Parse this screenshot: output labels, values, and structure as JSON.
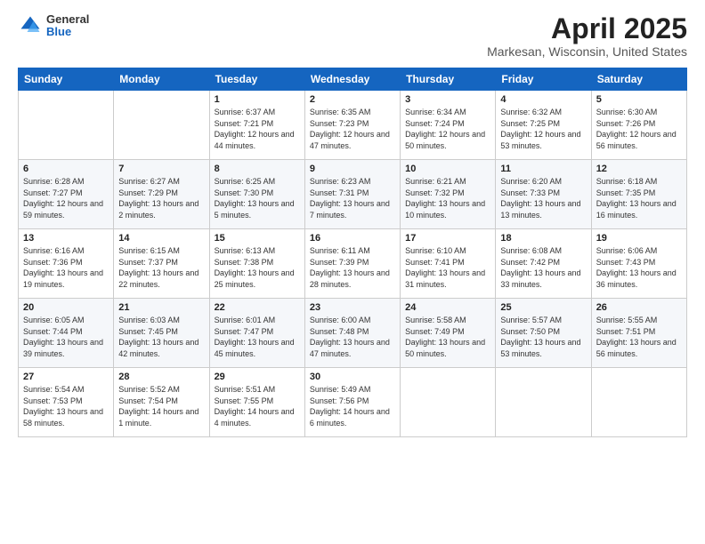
{
  "header": {
    "logo_general": "General",
    "logo_blue": "Blue",
    "month_title": "April 2025",
    "location": "Markesan, Wisconsin, United States"
  },
  "weekdays": [
    "Sunday",
    "Monday",
    "Tuesday",
    "Wednesday",
    "Thursday",
    "Friday",
    "Saturday"
  ],
  "weeks": [
    [
      {
        "day": "",
        "sunrise": "",
        "sunset": "",
        "daylight": ""
      },
      {
        "day": "",
        "sunrise": "",
        "sunset": "",
        "daylight": ""
      },
      {
        "day": "1",
        "sunrise": "Sunrise: 6:37 AM",
        "sunset": "Sunset: 7:21 PM",
        "daylight": "Daylight: 12 hours and 44 minutes."
      },
      {
        "day": "2",
        "sunrise": "Sunrise: 6:35 AM",
        "sunset": "Sunset: 7:23 PM",
        "daylight": "Daylight: 12 hours and 47 minutes."
      },
      {
        "day": "3",
        "sunrise": "Sunrise: 6:34 AM",
        "sunset": "Sunset: 7:24 PM",
        "daylight": "Daylight: 12 hours and 50 minutes."
      },
      {
        "day": "4",
        "sunrise": "Sunrise: 6:32 AM",
        "sunset": "Sunset: 7:25 PM",
        "daylight": "Daylight: 12 hours and 53 minutes."
      },
      {
        "day": "5",
        "sunrise": "Sunrise: 6:30 AM",
        "sunset": "Sunset: 7:26 PM",
        "daylight": "Daylight: 12 hours and 56 minutes."
      }
    ],
    [
      {
        "day": "6",
        "sunrise": "Sunrise: 6:28 AM",
        "sunset": "Sunset: 7:27 PM",
        "daylight": "Daylight: 12 hours and 59 minutes."
      },
      {
        "day": "7",
        "sunrise": "Sunrise: 6:27 AM",
        "sunset": "Sunset: 7:29 PM",
        "daylight": "Daylight: 13 hours and 2 minutes."
      },
      {
        "day": "8",
        "sunrise": "Sunrise: 6:25 AM",
        "sunset": "Sunset: 7:30 PM",
        "daylight": "Daylight: 13 hours and 5 minutes."
      },
      {
        "day": "9",
        "sunrise": "Sunrise: 6:23 AM",
        "sunset": "Sunset: 7:31 PM",
        "daylight": "Daylight: 13 hours and 7 minutes."
      },
      {
        "day": "10",
        "sunrise": "Sunrise: 6:21 AM",
        "sunset": "Sunset: 7:32 PM",
        "daylight": "Daylight: 13 hours and 10 minutes."
      },
      {
        "day": "11",
        "sunrise": "Sunrise: 6:20 AM",
        "sunset": "Sunset: 7:33 PM",
        "daylight": "Daylight: 13 hours and 13 minutes."
      },
      {
        "day": "12",
        "sunrise": "Sunrise: 6:18 AM",
        "sunset": "Sunset: 7:35 PM",
        "daylight": "Daylight: 13 hours and 16 minutes."
      }
    ],
    [
      {
        "day": "13",
        "sunrise": "Sunrise: 6:16 AM",
        "sunset": "Sunset: 7:36 PM",
        "daylight": "Daylight: 13 hours and 19 minutes."
      },
      {
        "day": "14",
        "sunrise": "Sunrise: 6:15 AM",
        "sunset": "Sunset: 7:37 PM",
        "daylight": "Daylight: 13 hours and 22 minutes."
      },
      {
        "day": "15",
        "sunrise": "Sunrise: 6:13 AM",
        "sunset": "Sunset: 7:38 PM",
        "daylight": "Daylight: 13 hours and 25 minutes."
      },
      {
        "day": "16",
        "sunrise": "Sunrise: 6:11 AM",
        "sunset": "Sunset: 7:39 PM",
        "daylight": "Daylight: 13 hours and 28 minutes."
      },
      {
        "day": "17",
        "sunrise": "Sunrise: 6:10 AM",
        "sunset": "Sunset: 7:41 PM",
        "daylight": "Daylight: 13 hours and 31 minutes."
      },
      {
        "day": "18",
        "sunrise": "Sunrise: 6:08 AM",
        "sunset": "Sunset: 7:42 PM",
        "daylight": "Daylight: 13 hours and 33 minutes."
      },
      {
        "day": "19",
        "sunrise": "Sunrise: 6:06 AM",
        "sunset": "Sunset: 7:43 PM",
        "daylight": "Daylight: 13 hours and 36 minutes."
      }
    ],
    [
      {
        "day": "20",
        "sunrise": "Sunrise: 6:05 AM",
        "sunset": "Sunset: 7:44 PM",
        "daylight": "Daylight: 13 hours and 39 minutes."
      },
      {
        "day": "21",
        "sunrise": "Sunrise: 6:03 AM",
        "sunset": "Sunset: 7:45 PM",
        "daylight": "Daylight: 13 hours and 42 minutes."
      },
      {
        "day": "22",
        "sunrise": "Sunrise: 6:01 AM",
        "sunset": "Sunset: 7:47 PM",
        "daylight": "Daylight: 13 hours and 45 minutes."
      },
      {
        "day": "23",
        "sunrise": "Sunrise: 6:00 AM",
        "sunset": "Sunset: 7:48 PM",
        "daylight": "Daylight: 13 hours and 47 minutes."
      },
      {
        "day": "24",
        "sunrise": "Sunrise: 5:58 AM",
        "sunset": "Sunset: 7:49 PM",
        "daylight": "Daylight: 13 hours and 50 minutes."
      },
      {
        "day": "25",
        "sunrise": "Sunrise: 5:57 AM",
        "sunset": "Sunset: 7:50 PM",
        "daylight": "Daylight: 13 hours and 53 minutes."
      },
      {
        "day": "26",
        "sunrise": "Sunrise: 5:55 AM",
        "sunset": "Sunset: 7:51 PM",
        "daylight": "Daylight: 13 hours and 56 minutes."
      }
    ],
    [
      {
        "day": "27",
        "sunrise": "Sunrise: 5:54 AM",
        "sunset": "Sunset: 7:53 PM",
        "daylight": "Daylight: 13 hours and 58 minutes."
      },
      {
        "day": "28",
        "sunrise": "Sunrise: 5:52 AM",
        "sunset": "Sunset: 7:54 PM",
        "daylight": "Daylight: 14 hours and 1 minute."
      },
      {
        "day": "29",
        "sunrise": "Sunrise: 5:51 AM",
        "sunset": "Sunset: 7:55 PM",
        "daylight": "Daylight: 14 hours and 4 minutes."
      },
      {
        "day": "30",
        "sunrise": "Sunrise: 5:49 AM",
        "sunset": "Sunset: 7:56 PM",
        "daylight": "Daylight: 14 hours and 6 minutes."
      },
      {
        "day": "",
        "sunrise": "",
        "sunset": "",
        "daylight": ""
      },
      {
        "day": "",
        "sunrise": "",
        "sunset": "",
        "daylight": ""
      },
      {
        "day": "",
        "sunrise": "",
        "sunset": "",
        "daylight": ""
      }
    ]
  ]
}
